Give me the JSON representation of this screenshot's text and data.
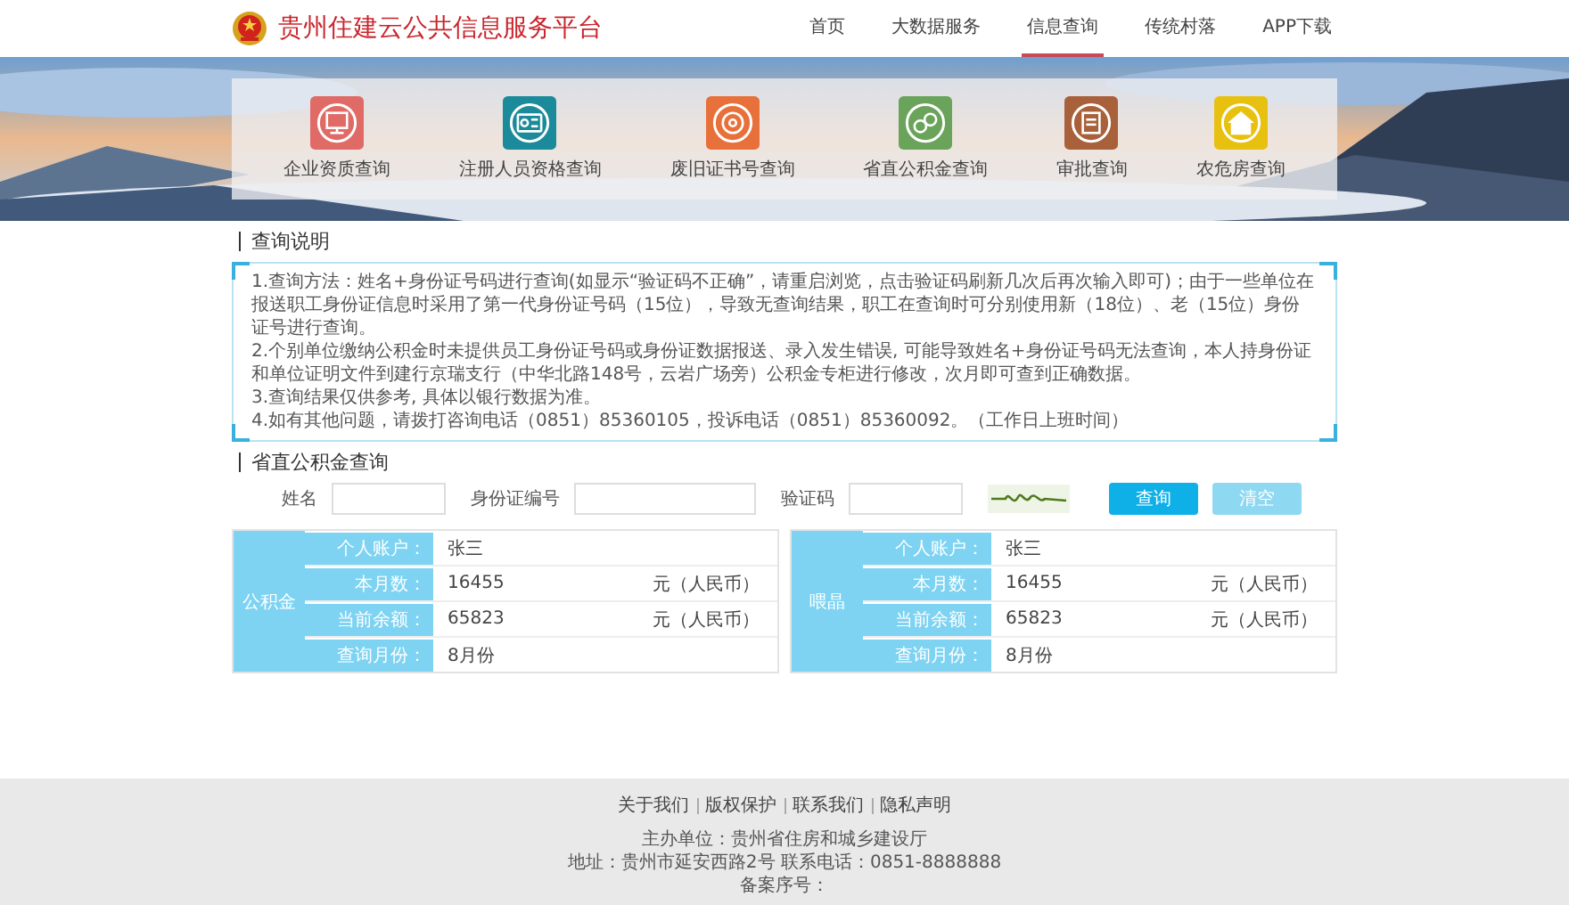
{
  "header": {
    "title": "贵州住建云公共信息服务平台",
    "nav": [
      {
        "label": "首页",
        "selected": false
      },
      {
        "label": "大数据服务",
        "selected": false
      },
      {
        "label": "信息查询",
        "selected": true
      },
      {
        "label": "传统村落",
        "selected": false
      },
      {
        "label": "APP下载",
        "selected": false
      }
    ]
  },
  "banner": {
    "kind": "picture",
    "services": [
      {
        "label": "企业资质查询",
        "color": "#e06a66"
      },
      {
        "label": "注册人员资格查询",
        "color": "#1b8a9a"
      },
      {
        "label": "废旧证书号查询",
        "color": "#e8703a"
      },
      {
        "label": "省直公积金查询",
        "color": "#6aa35a"
      },
      {
        "label": "审批查询",
        "color": "#a8613a"
      },
      {
        "label": "农危房查询",
        "color": "#e8c010"
      }
    ]
  },
  "notice": {
    "title": "查询说明",
    "paragraphs": [
      "1.查询方法：姓名+身份证号码进行查询(如显示“验证码不正确”，请重启浏览，点击验证码刷新几次后再次输入即可)；由于一些单位在报送职工身份证信息时采用了第一代身份证号码（15位），导致无查询结果，职工在查询时可分别使用新（18位）、老（15位）身份证号进行查询。",
      "2.个别单位缴纳公积金时未提供员工身份证号码或身份证数据报送、录入发生错误, 可能导致姓名+身份证号码无法查询，本人持身份证和单位证明文件到建行京瑞支行（中华北路148号，云岩广场旁）公积金专柜进行修改，次月即可查到正确数据。",
      "3.查询结果仅供参考, 具体以银行数据为准。",
      "4.如有其他问题，请拨打咨询电话（0851）85360105，投诉电话（0851）85360092。（工作日上班时间）"
    ]
  },
  "query": {
    "title": "省直公积金查询",
    "fields": [
      {
        "label": "姓名",
        "kind": "text"
      },
      {
        "label": "身份证编号",
        "kind": "wide"
      },
      {
        "label": "验证码",
        "kind": "text"
      }
    ],
    "buttons": [
      {
        "label": "查询",
        "kind": "primary"
      },
      {
        "label": "清空",
        "kind": "secondary"
      }
    ]
  },
  "results": [
    {
      "group": "公积金",
      "rows": [
        {
          "label": "个人账户：",
          "value": "张三"
        },
        {
          "label": "本月数：",
          "value": "16455",
          "unit": "元（人民币）"
        },
        {
          "label": "当前余额：",
          "value": "65823",
          "unit": "元（人民币）"
        },
        {
          "label": "查询月份：",
          "value": "8月份"
        }
      ]
    },
    {
      "group": "喂晶",
      "rows": [
        {
          "label": "个人账户：",
          "value": "张三"
        },
        {
          "label": "本月数：",
          "value": "16455",
          "unit": "元（人民币）"
        },
        {
          "label": "当前余额：",
          "value": "65823",
          "unit": "元（人民币）"
        },
        {
          "label": "查询月份：",
          "value": "8月份"
        }
      ]
    }
  ],
  "footer": {
    "links": [
      "关于我们",
      "版权保护",
      "联系我们",
      "隐私声明"
    ],
    "lines": [
      "主办单位：贵州省住房和城乡建设厅",
      "地址：贵州市延安西路2号  联系电话：0851-8888888",
      "备案序号："
    ]
  }
}
